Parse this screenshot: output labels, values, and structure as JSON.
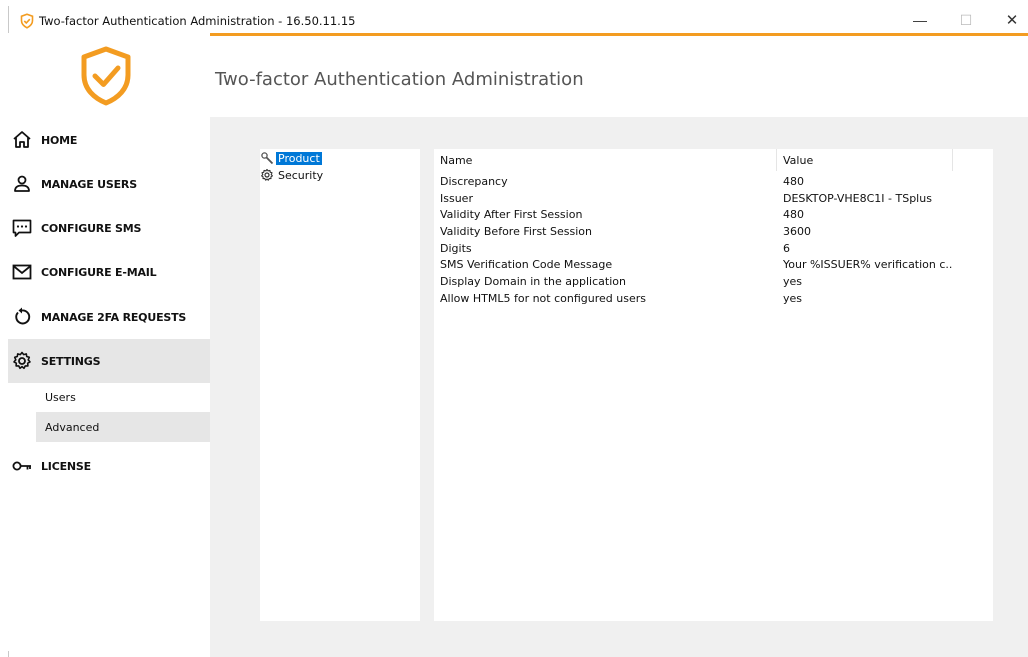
{
  "window": {
    "title": "Two-factor Authentication Administration - 16.50.11.15",
    "minimize_glyph": "—",
    "maximize_glyph": "☐",
    "close_glyph": "✕"
  },
  "header": {
    "title": "Two-factor Authentication Administration"
  },
  "sidebar": {
    "items": [
      {
        "label": "HOME",
        "icon": "home-icon"
      },
      {
        "label": "MANAGE USERS",
        "icon": "user-icon"
      },
      {
        "label": "CONFIGURE SMS",
        "icon": "sms-icon"
      },
      {
        "label": "CONFIGURE E-MAIL",
        "icon": "mail-icon"
      },
      {
        "label": "MANAGE 2FA REQUESTS",
        "icon": "refresh-icon"
      },
      {
        "label": "SETTINGS",
        "icon": "gear-icon"
      },
      {
        "label": "LICENSE",
        "icon": "key-icon"
      }
    ],
    "settings_sub": [
      {
        "label": "Users"
      },
      {
        "label": "Advanced"
      }
    ]
  },
  "tree": {
    "items": [
      {
        "label": "Product",
        "icon": "wrench-icon"
      },
      {
        "label": "Security",
        "icon": "gear-icon"
      }
    ]
  },
  "grid": {
    "columns": [
      "Name",
      "Value"
    ],
    "rows": [
      {
        "name": "Discrepancy",
        "value": "480"
      },
      {
        "name": "Issuer",
        "value": "DESKTOP-VHE8C1I - TSplus"
      },
      {
        "name": "Validity After First Session",
        "value": "480"
      },
      {
        "name": "Validity Before First Session",
        "value": "3600"
      },
      {
        "name": "Digits",
        "value": "6"
      },
      {
        "name": "SMS Verification Code Message",
        "value": "Your %ISSUER% verification c..."
      },
      {
        "name": "Display Domain in the application",
        "value": "yes"
      },
      {
        "name": "Allow HTML5 for not configured users",
        "value": "yes"
      }
    ]
  },
  "colors": {
    "accent": "#f39c21",
    "selection": "#0078d7",
    "content_bg": "#f0f0f0",
    "active_nav_bg": "#e6e6e6"
  }
}
